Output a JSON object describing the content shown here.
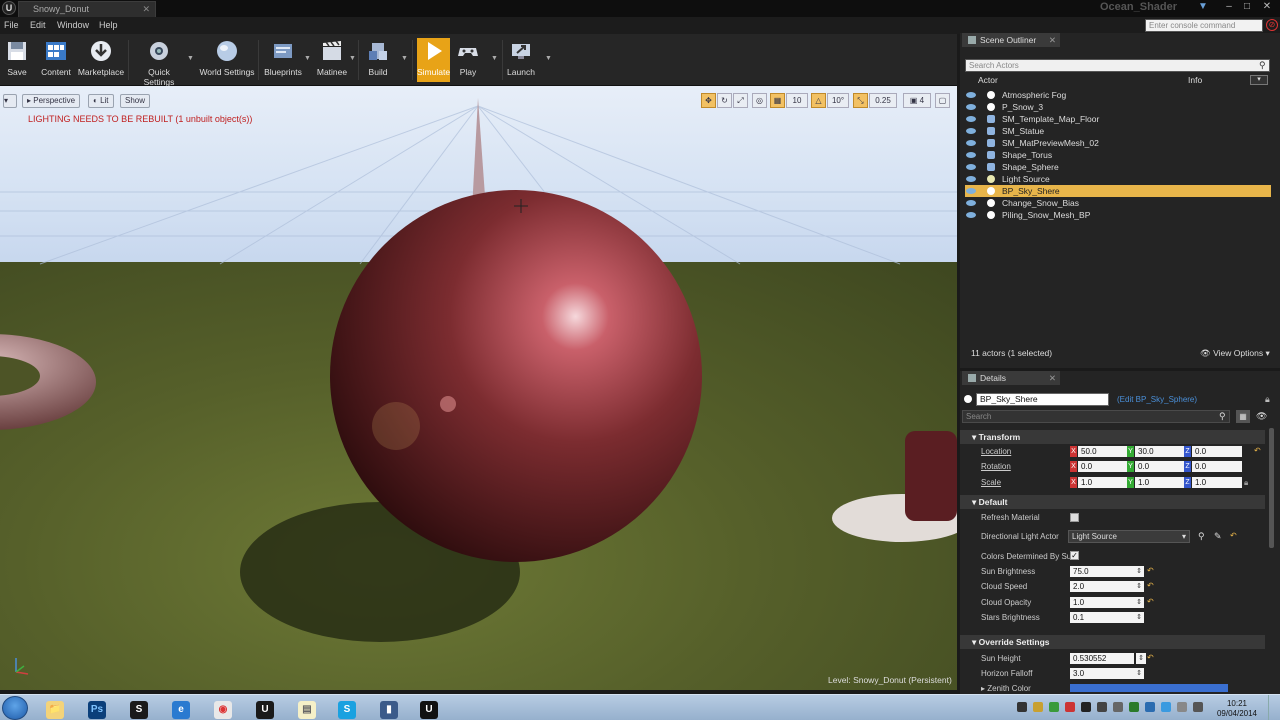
{
  "window": {
    "tab_title": "Snowy_Donut",
    "project_name": "Ocean_Shader",
    "controls": {
      "minimize": "–",
      "maximize": "□",
      "close": "✕"
    }
  },
  "menu": [
    "File",
    "Edit",
    "Window",
    "Help"
  ],
  "console": {
    "placeholder": "Enter console command"
  },
  "toolbar": {
    "buttons": [
      {
        "label": "Save",
        "icon": "save-icon"
      },
      {
        "label": "Content",
        "icon": "content-browser-icon"
      },
      {
        "label": "Marketplace",
        "icon": "marketplace-icon"
      },
      {
        "label": "Quick Settings",
        "icon": "quick-settings-icon"
      },
      {
        "label": "World Settings",
        "icon": "world-settings-icon"
      },
      {
        "label": "Blueprints",
        "icon": "blueprints-icon"
      },
      {
        "label": "Matinee",
        "icon": "matinee-icon"
      },
      {
        "label": "Build",
        "icon": "build-icon"
      },
      {
        "label": "Simulate",
        "icon": "play-triangle-icon",
        "active": true
      },
      {
        "label": "Play",
        "icon": "gamepad-icon"
      },
      {
        "label": "Launch",
        "icon": "launch-icon"
      }
    ]
  },
  "viewport": {
    "perspective_label": "Perspective",
    "lit_label": "Lit",
    "show_label": "Show",
    "grid_snap": "10",
    "rotation_snap": "10°",
    "scale_snap": "0.25",
    "camera_speed": "4",
    "warning": "LIGHTING NEEDS TO BE REBUILT (1 unbuilt object(s))",
    "level_label": "Level:",
    "level_name": "Snowy_Donut (Persistent)"
  },
  "outliner": {
    "tab": "Scene Outliner",
    "search_placeholder": "Search Actors",
    "col_actor": "Actor",
    "col_info": "Info",
    "actors": [
      {
        "name": "Atmospheric Fog",
        "icon": "fog-icon"
      },
      {
        "name": "P_Snow_3",
        "icon": "particle-icon"
      },
      {
        "name": "SM_Template_Map_Floor",
        "icon": "person-icon"
      },
      {
        "name": "SM_Statue",
        "icon": "person-icon"
      },
      {
        "name": "SM_MatPreviewMesh_02",
        "icon": "person-icon"
      },
      {
        "name": "Shape_Torus",
        "icon": "person-icon"
      },
      {
        "name": "Shape_Sphere",
        "icon": "person-icon"
      },
      {
        "name": "Light Source",
        "icon": "light-icon"
      },
      {
        "name": "BP_Sky_Shere",
        "icon": "blueprint-icon",
        "selected": true
      },
      {
        "name": "Change_Snow_Bias",
        "icon": "blueprint-icon"
      },
      {
        "name": "Piling_Snow_Mesh_BP",
        "icon": "blueprint-icon"
      }
    ],
    "summary": "11 actors (1 selected)",
    "view_options": "View Options"
  },
  "details": {
    "tab": "Details",
    "actor_name": "BP_Sky_Shere",
    "edit_link": "(Edit BP_Sky_Sphere)",
    "search_placeholder": "Search",
    "transform_title": "Transform",
    "location": {
      "label": "Location",
      "x": "50.0",
      "y": "30.0",
      "z": "0.0"
    },
    "rotation": {
      "label": "Rotation",
      "x": "0.0",
      "y": "0.0",
      "z": "0.0"
    },
    "scale": {
      "label": "Scale",
      "x": "1.0",
      "y": "1.0",
      "z": "1.0"
    },
    "default_title": "Default",
    "refresh_material": "Refresh Material",
    "directional_light": {
      "label": "Directional Light Actor",
      "value": "Light Source"
    },
    "colors_determined": "Colors Determined By Su",
    "sun_brightness": {
      "label": "Sun Brightness",
      "value": "75.0"
    },
    "cloud_speed": {
      "label": "Cloud Speed",
      "value": "2.0"
    },
    "cloud_opacity": {
      "label": "Cloud Opacity",
      "value": "1.0"
    },
    "stars_brightness": {
      "label": "Stars Brightness",
      "value": "0.1"
    },
    "override_title": "Override Settings",
    "sun_height": {
      "label": "Sun Height",
      "value": "0.530552"
    },
    "horizon_falloff": {
      "label": "Horizon Falloff",
      "value": "3.0"
    },
    "zenith_color": {
      "label": "Zenith Color"
    }
  },
  "taskbar": {
    "apps": [
      {
        "name": "explorer",
        "glyph": "📁"
      },
      {
        "name": "photoshop",
        "glyph": "Ps"
      },
      {
        "name": "steam",
        "glyph": "S"
      },
      {
        "name": "browser-blue",
        "glyph": "e"
      },
      {
        "name": "chrome",
        "glyph": "◉"
      },
      {
        "name": "unreal-engine",
        "glyph": "U"
      },
      {
        "name": "folder",
        "glyph": "▤"
      },
      {
        "name": "skype",
        "glyph": "S"
      },
      {
        "name": "film-editor",
        "glyph": "▮"
      },
      {
        "name": "unreal-editor",
        "glyph": "U"
      }
    ],
    "time": "10:21",
    "date": "09/04/2014"
  },
  "colors": {
    "accent": "#e8b54a",
    "warning": "#c02020",
    "link": "#4a8fd8"
  }
}
